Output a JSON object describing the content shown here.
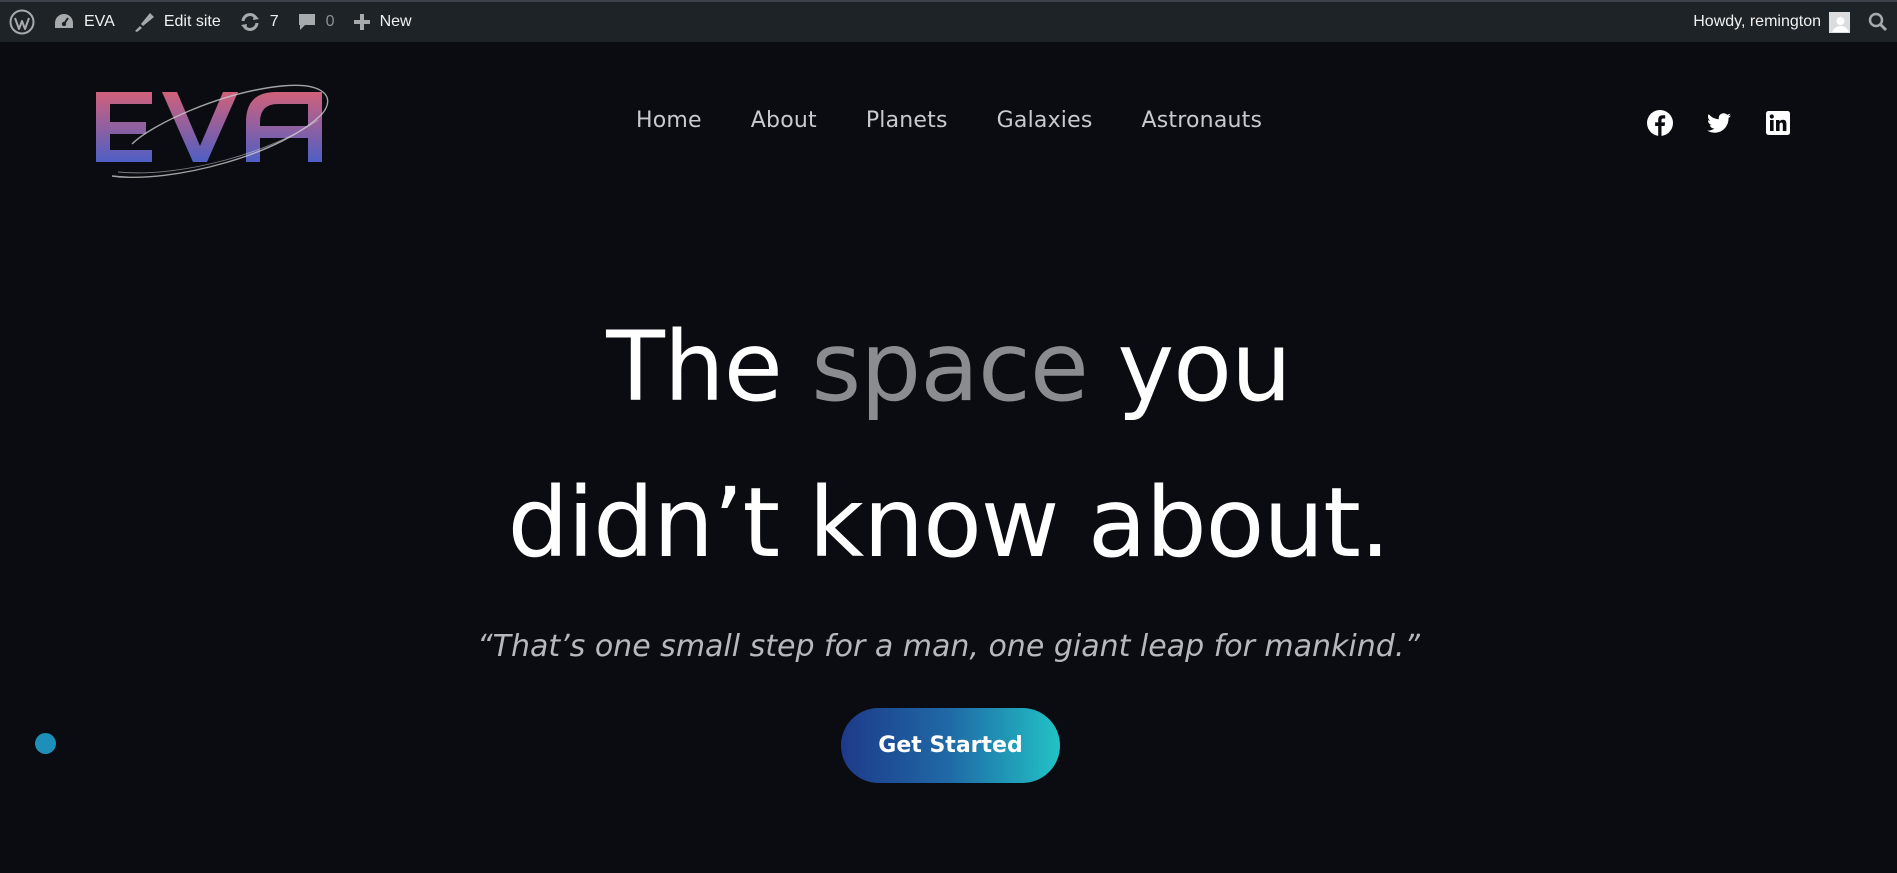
{
  "admin_bar": {
    "site_name": "EVA",
    "edit_site": "Edit site",
    "updates_count": "7",
    "comments_count": "0",
    "new_label": "New",
    "greeting": "Howdy, remington"
  },
  "logo": {
    "text": "EVA",
    "gradient_from": "#d0607a",
    "gradient_to": "#4f5fc5"
  },
  "nav": {
    "items": [
      {
        "label": "Home"
      },
      {
        "label": "About"
      },
      {
        "label": "Planets"
      },
      {
        "label": "Galaxies"
      },
      {
        "label": "Astronauts"
      }
    ]
  },
  "social": {
    "icons": [
      "facebook-icon",
      "twitter-icon",
      "linkedin-icon"
    ]
  },
  "hero": {
    "line1_start": "The",
    "line1_accent": "space",
    "line1_end": "you",
    "line2": "didn’t know about.",
    "quote": "“That’s one small step for a man, one giant leap for mankind.”",
    "cta_label": "Get Started"
  },
  "colors": {
    "background": "#0b0c11",
    "admin_bar": "#1d2327",
    "accent_text": "#8b8c90",
    "cta_gradient_start": "#1e3a8a",
    "cta_gradient_end": "#22c2c6",
    "floating_dot": "#1e8fb8"
  }
}
